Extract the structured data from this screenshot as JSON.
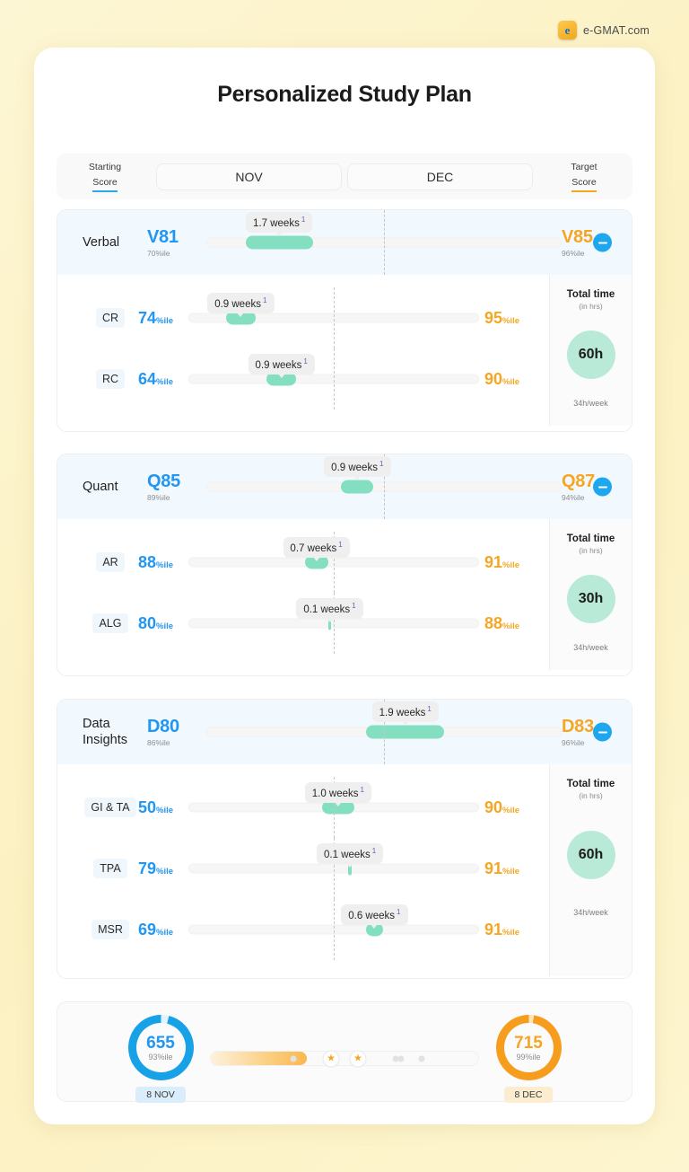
{
  "brand": {
    "name": "e-GMAT.com",
    "logo_letter": "e",
    "icon": "egmat-logo-icon"
  },
  "page_title": "Personalized Study Plan",
  "timeline": {
    "starting_label_line1": "Starting",
    "starting_label_line2": "Score",
    "target_label_line1": "Target",
    "target_label_line2": "Score",
    "months": [
      "NOV",
      "DEC"
    ],
    "starting_accent": "#2aa8e8",
    "target_accent": "#f5a623"
  },
  "sections": [
    {
      "name": "Verbal",
      "start_score": "V81",
      "start_pct": "70%ile",
      "target_score": "V85",
      "target_pct": "96%ile",
      "weeks": "1.7 weeks",
      "weeks_note": "1",
      "bar_left_pct": 11,
      "bar_width_pct": 19,
      "collapse_icon": "minus-circle-icon",
      "total": {
        "title": "Total time",
        "units": "(in hrs)",
        "hours": "60h",
        "per_week": "34h/week"
      },
      "rows": [
        {
          "label": "CR",
          "start": "74",
          "start_suffix": "%ile",
          "target": "95",
          "target_suffix": "%ile",
          "weeks": "0.9 weeks",
          "weeks_note": "1",
          "bar_left_pct": 13,
          "bar_width_pct": 10
        },
        {
          "label": "RC",
          "start": "64",
          "start_suffix": "%ile",
          "target": "90",
          "target_suffix": "%ile",
          "weeks": "0.9 weeks",
          "weeks_note": "1",
          "bar_left_pct": 27,
          "bar_width_pct": 10
        }
      ]
    },
    {
      "name": "Quant",
      "start_score": "Q85",
      "start_pct": "89%ile",
      "target_score": "Q87",
      "target_pct": "94%ile",
      "weeks": "0.9 weeks",
      "weeks_note": "1",
      "bar_left_pct": 38,
      "bar_width_pct": 9,
      "collapse_icon": "minus-circle-icon",
      "total": {
        "title": "Total time",
        "units": "(in hrs)",
        "hours": "30h",
        "per_week": "34h/week"
      },
      "rows": [
        {
          "label": "AR",
          "start": "88",
          "start_suffix": "%ile",
          "target": "91",
          "target_suffix": "%ile",
          "weeks": "0.7 weeks",
          "weeks_note": "1",
          "bar_left_pct": 40,
          "bar_width_pct": 8
        },
        {
          "label": "ALG",
          "start": "80",
          "start_suffix": "%ile",
          "target": "88",
          "target_suffix": "%ile",
          "weeks": "0.1 weeks",
          "weeks_note": "1",
          "bar_left_pct": 48,
          "bar_width_pct": 1.2
        }
      ]
    },
    {
      "name": "Data Insights",
      "start_score": "D80",
      "start_pct": "86%ile",
      "target_score": "D83",
      "target_pct": "96%ile",
      "weeks": "1.9 weeks",
      "weeks_note": "1",
      "bar_left_pct": 45,
      "bar_width_pct": 22,
      "collapse_icon": "minus-circle-icon",
      "total": {
        "title": "Total time",
        "units": "(in hrs)",
        "hours": "60h",
        "per_week": "34h/week"
      },
      "rows": [
        {
          "label": "GI & TA",
          "start": "50",
          "start_suffix": "%ile",
          "target": "90",
          "target_suffix": "%ile",
          "weeks": "1.0 weeks",
          "weeks_note": "1",
          "bar_left_pct": 46,
          "bar_width_pct": 11
        },
        {
          "label": "TPA",
          "start": "79",
          "start_suffix": "%ile",
          "target": "91",
          "target_suffix": "%ile",
          "weeks": "0.1 weeks",
          "weeks_note": "1",
          "bar_left_pct": 55,
          "bar_width_pct": 1.2
        },
        {
          "label": "MSR",
          "start": "69",
          "start_suffix": "%ile",
          "target": "91",
          "target_suffix": "%ile",
          "weeks": "0.6 weeks",
          "weeks_note": "1",
          "bar_left_pct": 61,
          "bar_width_pct": 6
        }
      ]
    }
  ],
  "summary": {
    "start": {
      "score": "655",
      "pct": "93%ile",
      "date": "8 NOV",
      "color": "#17a2e8"
    },
    "target": {
      "score": "715",
      "pct": "99%ile",
      "date": "8 DEC",
      "color": "#f79d1e"
    },
    "progress_percent": 36,
    "markers": [
      {
        "type": "dot",
        "pos": 31
      },
      {
        "type": "star",
        "pos": 45
      },
      {
        "type": "star",
        "pos": 55
      },
      {
        "type": "dot",
        "pos": 69
      },
      {
        "type": "dot",
        "pos": 71
      },
      {
        "type": "dot",
        "pos": 79
      }
    ]
  },
  "colors": {
    "page_bg": "#fcf3c9",
    "blue": "#2196f3",
    "orange": "#f5a623",
    "green_bar": "#84dfc0",
    "mint_circle": "#b9ead8"
  }
}
